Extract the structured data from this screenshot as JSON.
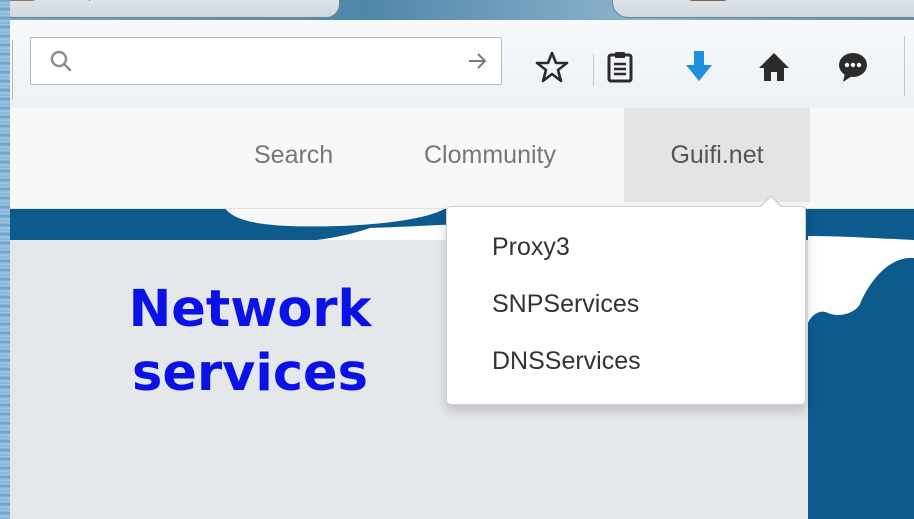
{
  "browser": {
    "search_placeholder": "",
    "icons": [
      "search-icon",
      "go-arrow-icon",
      "bookmark-star-icon",
      "reading-list-icon",
      "downloads-icon",
      "home-icon",
      "chat-icon"
    ],
    "colors": {
      "downloads_icon": "#1f8fe0",
      "toolbar_icons": "#2b2b2b"
    }
  },
  "navbar": {
    "items": [
      {
        "label": "Search"
      },
      {
        "label": "Clommunity"
      },
      {
        "label": "Guifi.net"
      }
    ],
    "active_index": 2
  },
  "dropdown": {
    "items": [
      {
        "label": "Proxy3"
      },
      {
        "label": "SNPServices"
      },
      {
        "label": "DNSServices"
      }
    ]
  },
  "slide": {
    "headline_line1": "Network",
    "headline_line2": "services",
    "headline_color": "#0a12e6",
    "accent_color": "#0d5a8e"
  }
}
